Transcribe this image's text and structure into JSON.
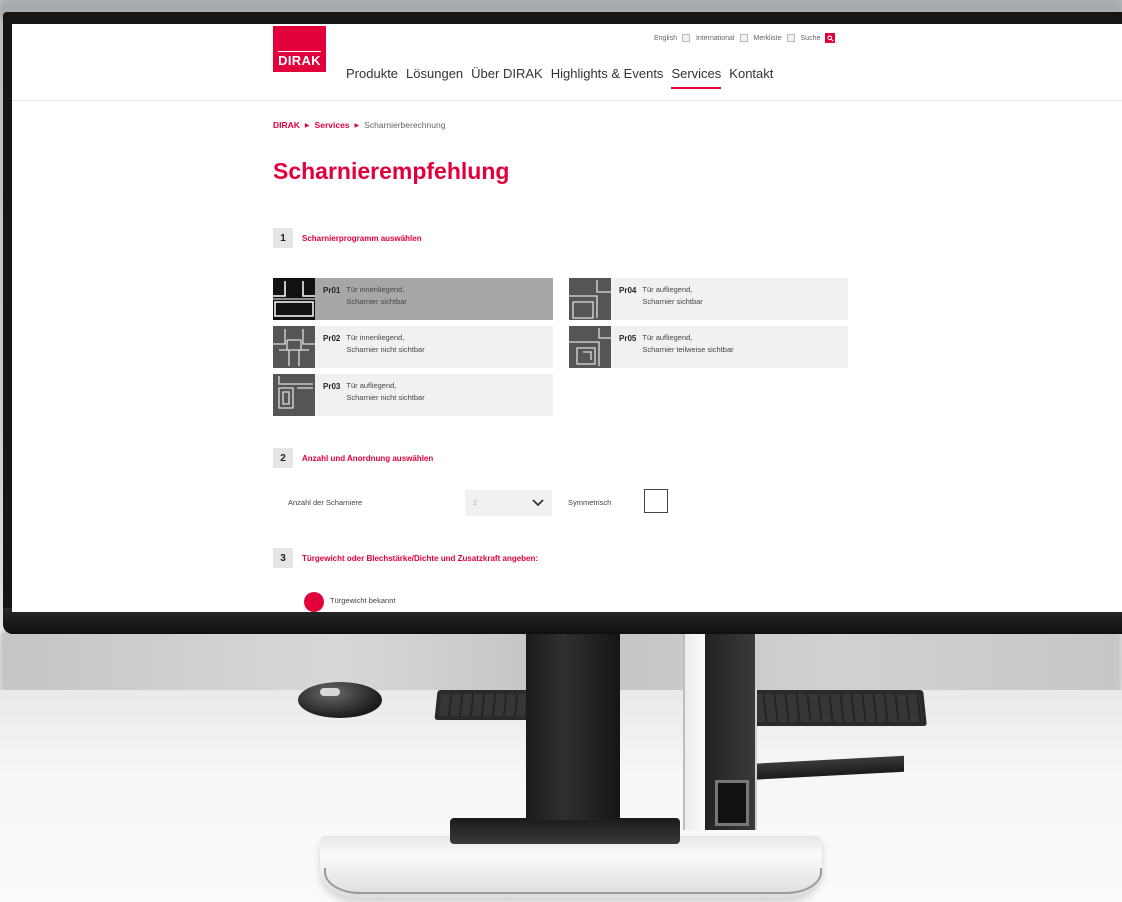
{
  "site": {
    "logo_text": "DIRAK",
    "accent_color": "#e2003c",
    "utility_nav": [
      "English",
      "International",
      "Merkliste",
      "Suche"
    ],
    "main_nav": [
      {
        "label": "Produkte",
        "active": false
      },
      {
        "label": "Lösungen",
        "active": false
      },
      {
        "label": "Über DIRAK",
        "active": false
      },
      {
        "label": "Highlights & Events",
        "active": false
      },
      {
        "label": "Services",
        "active": true
      },
      {
        "label": "Kontakt",
        "active": false
      }
    ]
  },
  "breadcrumb": {
    "items": [
      "DIRAK",
      "Services"
    ],
    "current": "Scharnierberechnung"
  },
  "page": {
    "title": "Scharnierempfehlung"
  },
  "steps": [
    {
      "number": "1",
      "label": "Scharnierprogramm auswählen"
    },
    {
      "number": "2",
      "label": "Anzahl und Anordnung auswählen"
    },
    {
      "number": "3",
      "label": "Türgewicht oder Blechstärke/Dichte und Zusatzkraft angeben:"
    }
  ],
  "programs": [
    {
      "code": "Pr01",
      "line1": "Tür innenliegend,",
      "line2": "Scharnier sichtbar",
      "selected": true
    },
    {
      "code": "Pr02",
      "line1": "Tür innenliegend,",
      "line2": "Scharnier nicht sichtbar",
      "selected": false
    },
    {
      "code": "Pr03",
      "line1": "Tür aufliegend,",
      "line2": "Scharnier nicht sichtbar",
      "selected": false
    },
    {
      "code": "Pr04",
      "line1": "Tür aufliegend,",
      "line2": "Scharnier sichtbar",
      "selected": false
    },
    {
      "code": "Pr05",
      "line1": "Tür aufliegend,",
      "line2": "Scharnier teilweise sichtbar",
      "selected": false
    }
  ],
  "arrangement": {
    "count_label": "Anzahl der Scharniere",
    "count_value": "2",
    "symmetric_label": "Symmetrisch",
    "symmetric_checked": false
  },
  "weight": {
    "option_label": "Türgewicht bekannt",
    "selected": true
  }
}
